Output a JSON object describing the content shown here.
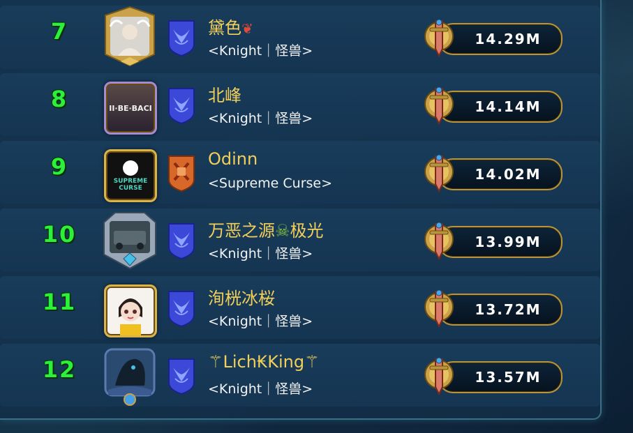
{
  "rows": [
    {
      "rank": "7",
      "name": "黛色",
      "name_suffix": "❦",
      "guild": "<Knight｜怪兽>",
      "power": "14.29M",
      "avatar": "angel-portrait",
      "badge": "wings-blue"
    },
    {
      "rank": "8",
      "name": "北峰",
      "name_suffix": "",
      "guild": "<Knight｜怪兽>",
      "power": "14.14M",
      "avatar_text": "II·BE·BACI",
      "avatar": "ii-be-baci",
      "badge": "wings-blue"
    },
    {
      "rank": "9",
      "name": "Odinn",
      "name_suffix": "",
      "guild": "<Supreme Curse>",
      "power": "14.02M",
      "avatar_text_1": "SUPREME",
      "avatar_text_2": "CURSE",
      "avatar": "supreme-curse-wolf",
      "badge": "axe-orange"
    },
    {
      "rank": "10",
      "name": "万恶之源",
      "name_mid": "☠",
      "name_end": "极光",
      "guild": "<Knight｜怪兽>",
      "power": "13.99M",
      "avatar": "armored-car",
      "badge": "wings-blue"
    },
    {
      "rank": "11",
      "name": "洵桄冰桜",
      "name_suffix": "",
      "guild": "<Knight｜怪兽>",
      "power": "13.72M",
      "avatar": "cartoon-girl",
      "badge": "wings-blue"
    },
    {
      "rank": "12",
      "name": "⚚Lich₭King⚚",
      "name_suffix": "",
      "guild": "<Knight｜怪兽>",
      "power": "13.57M",
      "avatar": "dark-dragon",
      "badge": "wings-blue"
    }
  ],
  "colors": {
    "rank": "#2cf03a",
    "name": "#f2cf58",
    "guild": "#f2f2f2",
    "pill_border": "#b8953c"
  }
}
